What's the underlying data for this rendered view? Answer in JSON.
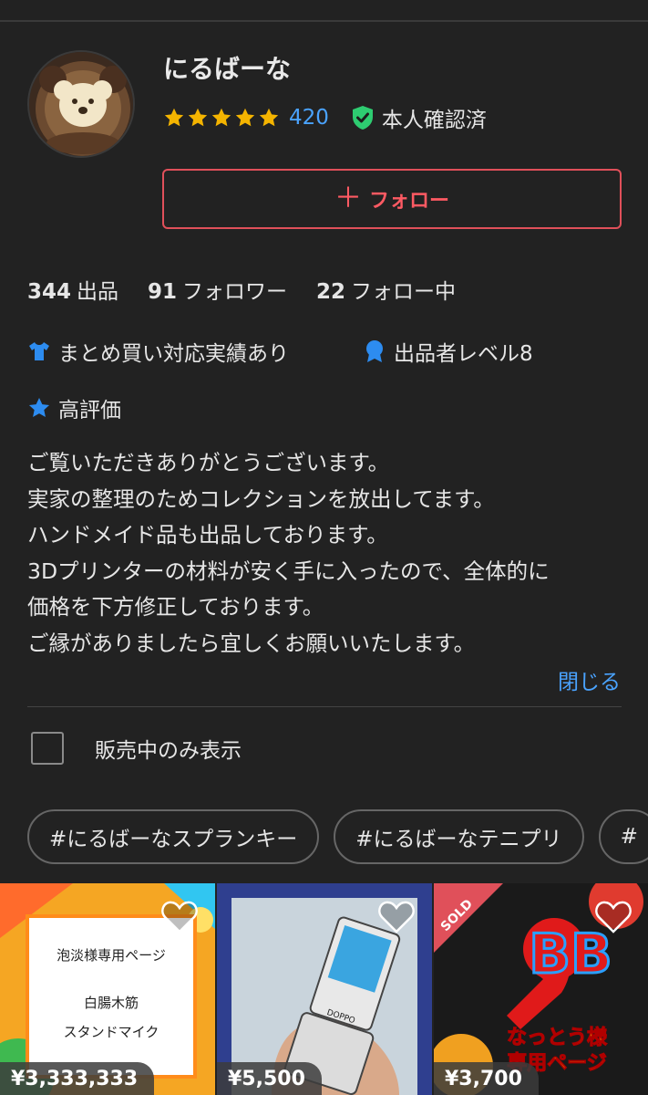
{
  "profile": {
    "name": "にるばーな",
    "rating_count": "420",
    "verified_label": "本人確認済",
    "follow_label": "フォロー"
  },
  "stats": {
    "listings_count": "344",
    "listings_label": "出品",
    "followers_count": "91",
    "followers_label": "フォロワー",
    "following_count": "22",
    "following_label": "フォロー中"
  },
  "badges": {
    "bundle": "まとめ買い対応実績あり",
    "level": "出品者レベル8",
    "rating": "高評価"
  },
  "bio": [
    "ご覧いただきありがとうございます。",
    "実家の整理のためコレクションを放出してます。",
    "ハンドメイド品も出品しております。",
    "3Dプリンターの材料が安く手に入ったので、全体的に",
    "価格を下方修正しております。",
    "ご縁がありましたら宜しくお願いいたします。"
  ],
  "close_label": "閉じる",
  "filter": {
    "on_sale_only": "販売中のみ表示",
    "checked": false
  },
  "tags": [
    "#にるばーなスプランキー",
    "#にるばーなテニプリ",
    "#"
  ],
  "items": [
    {
      "price": "¥3,333,333",
      "line1": "泡淡様専用ページ",
      "line2": "白腸木筋",
      "line3": "スタンドマイク",
      "sold": false
    },
    {
      "price": "¥5,500",
      "brand": "DOPPO",
      "sold": false
    },
    {
      "price": "¥3,700",
      "sold_label": "SOLD",
      "caption1": "なっとう様",
      "caption2": "専用ページ",
      "sold": true
    }
  ],
  "colors": {
    "accent_red": "#e0505a",
    "link_blue": "#4aa3ff",
    "star": "#f4b400",
    "verified": "#2ecc71"
  },
  "icons": [
    "star-icon",
    "shield-check-icon",
    "plus-icon",
    "shirt-icon",
    "medal-icon",
    "heart-icon"
  ]
}
